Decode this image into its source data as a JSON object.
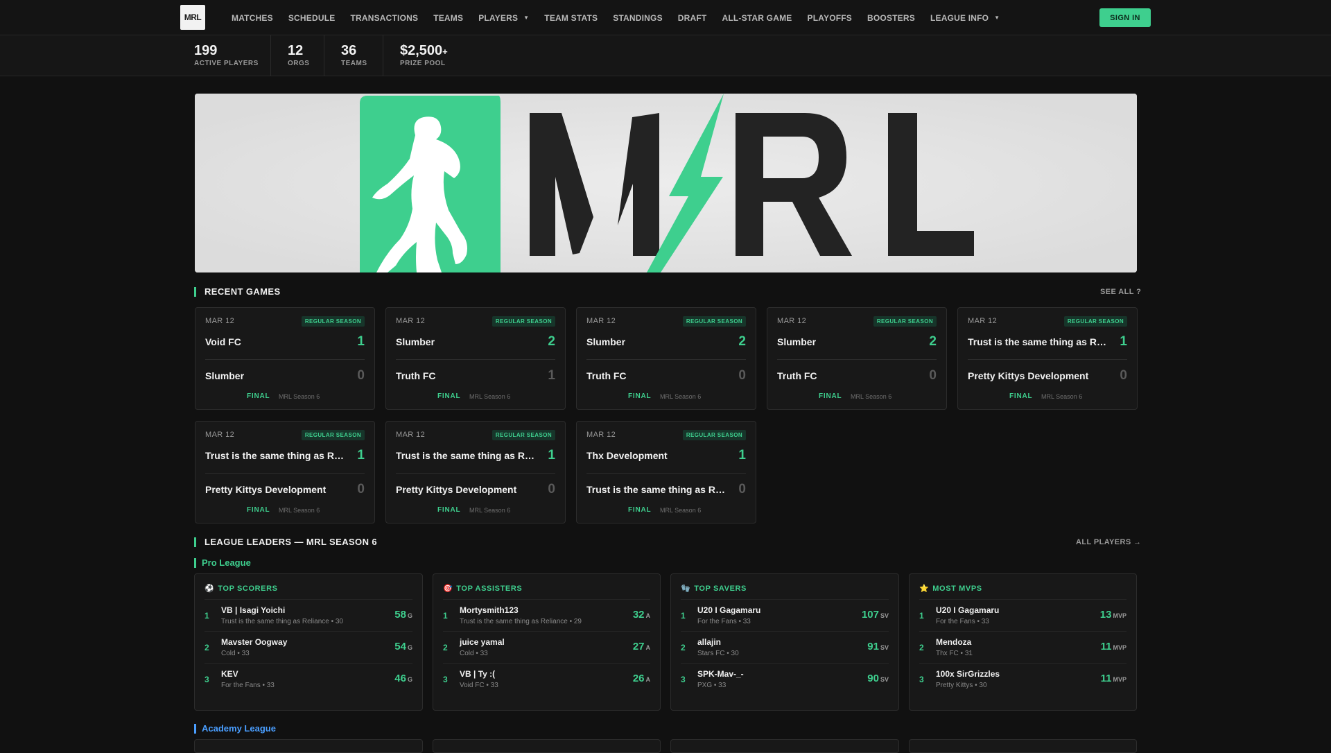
{
  "nav": {
    "logo_text": "MRL",
    "links": [
      {
        "label": "MATCHES",
        "dropdown": false
      },
      {
        "label": "SCHEDULE",
        "dropdown": false
      },
      {
        "label": "TRANSACTIONS",
        "dropdown": false
      },
      {
        "label": "TEAMS",
        "dropdown": false
      },
      {
        "label": "PLAYERS",
        "dropdown": true
      },
      {
        "label": "TEAM STATS",
        "dropdown": false
      },
      {
        "label": "STANDINGS",
        "dropdown": false
      },
      {
        "label": "DRAFT",
        "dropdown": false
      },
      {
        "label": "ALL-STAR GAME",
        "dropdown": false
      },
      {
        "label": "PLAYOFFS",
        "dropdown": false
      },
      {
        "label": "BOOSTERS",
        "dropdown": false
      },
      {
        "label": "LEAGUE INFO",
        "dropdown": true
      }
    ],
    "caret": "▼",
    "signin_label": "SIGN IN"
  },
  "stats": [
    {
      "value": "199",
      "suffix": "",
      "label": "ACTIVE PLAYERS"
    },
    {
      "value": "12",
      "suffix": "",
      "label": "ORGS"
    },
    {
      "value": "36",
      "suffix": "",
      "label": "TEAMS"
    },
    {
      "value": "$2,500",
      "suffix": "+",
      "label": "PRIZE POOL"
    }
  ],
  "banner": {
    "logo_text": "MRL"
  },
  "recent_games": {
    "title": "RECENT GAMES",
    "see_all": "SEE ALL ?",
    "games": [
      {
        "date": "MAR 12",
        "badge": "REGULAR SEASON",
        "team1": "Void FC",
        "score1": "1",
        "team2": "Slumber",
        "score2": "0",
        "status": "FINAL",
        "season": "MRL Season 6"
      },
      {
        "date": "MAR 12",
        "badge": "REGULAR SEASON",
        "team1": "Slumber",
        "score1": "2",
        "team2": "Truth FC",
        "score2": "1",
        "status": "FINAL",
        "season": "MRL Season 6"
      },
      {
        "date": "MAR 12",
        "badge": "REGULAR SEASON",
        "team1": "Slumber",
        "score1": "2",
        "team2": "Truth FC",
        "score2": "0",
        "status": "FINAL",
        "season": "MRL Season 6"
      },
      {
        "date": "MAR 12",
        "badge": "REGULAR SEASON",
        "team1": "Slumber",
        "score1": "2",
        "team2": "Truth FC",
        "score2": "0",
        "status": "FINAL",
        "season": "MRL Season 6"
      },
      {
        "date": "MAR 12",
        "badge": "REGULAR SEASON",
        "team1": "Trust is the same thing as Re...",
        "score1": "1",
        "team2": "Pretty Kittys Development",
        "score2": "0",
        "status": "FINAL",
        "season": "MRL Season 6"
      },
      {
        "date": "MAR 12",
        "badge": "REGULAR SEASON",
        "team1": "Trust is the same thing as Re...",
        "score1": "1",
        "team2": "Pretty Kittys Development",
        "score2": "0",
        "status": "FINAL",
        "season": "MRL Season 6"
      },
      {
        "date": "MAR 12",
        "badge": "REGULAR SEASON",
        "team1": "Trust is the same thing as Re...",
        "score1": "1",
        "team2": "Pretty Kittys Development",
        "score2": "0",
        "status": "FINAL",
        "season": "MRL Season 6"
      },
      {
        "date": "MAR 12",
        "badge": "REGULAR SEASON",
        "team1": "Thx Development",
        "score1": "1",
        "team2": "Trust is the same thing as Re...",
        "score2": "0",
        "status": "FINAL",
        "season": "MRL Season 6"
      }
    ]
  },
  "league_leaders": {
    "title": "LEAGUE LEADERS — MRL SEASON 6",
    "all_players": "ALL PLAYERS →",
    "pro_label": "Pro League",
    "academy_label": "Academy League",
    "categories": [
      {
        "title": "TOP SCORERS",
        "icon": "soccer-ball-icon",
        "glyph": "⚽",
        "unit": "G",
        "rows": [
          {
            "rank": "1",
            "name": "VB | Isagi Yoichi",
            "sub": "Trust is the same thing as Reliance • 30",
            "value": "58"
          },
          {
            "rank": "2",
            "name": "Mavster Oogway",
            "sub": "Cold • 33",
            "value": "54"
          },
          {
            "rank": "3",
            "name": "KEV",
            "sub": "For the Fans • 33",
            "value": "46"
          }
        ]
      },
      {
        "title": "TOP ASSISTERS",
        "icon": "target-icon",
        "glyph": "🎯",
        "unit": "A",
        "rows": [
          {
            "rank": "1",
            "name": "Mortysmith123",
            "sub": "Trust is the same thing as Reliance • 29",
            "value": "32"
          },
          {
            "rank": "2",
            "name": "juice yamal",
            "sub": "Cold • 33",
            "value": "27"
          },
          {
            "rank": "3",
            "name": "VB | Ty :(",
            "sub": "Void FC • 33",
            "value": "26"
          }
        ]
      },
      {
        "title": "TOP SAVERS",
        "icon": "goalkeeper-icon",
        "glyph": "🧤",
        "unit": "SV",
        "rows": [
          {
            "rank": "1",
            "name": "U20 I Gagamaru",
            "sub": "For the Fans • 33",
            "value": "107"
          },
          {
            "rank": "2",
            "name": "allajin",
            "sub": "Stars FC • 30",
            "value": "91"
          },
          {
            "rank": "3",
            "name": "SPK-Mav-_-",
            "sub": "PXG • 33",
            "value": "90"
          }
        ]
      },
      {
        "title": "MOST MVPS",
        "icon": "star-icon",
        "glyph": "⭐",
        "unit": "MVP",
        "rows": [
          {
            "rank": "1",
            "name": "U20 I Gagamaru",
            "sub": "For the Fans • 33",
            "value": "13"
          },
          {
            "rank": "2",
            "name": "Mendoza",
            "sub": "Thx FC • 31",
            "value": "11"
          },
          {
            "rank": "3",
            "name": "100x SirGrizzles",
            "sub": "Pretty Kittys • 30",
            "value": "11"
          }
        ]
      }
    ]
  },
  "colors": {
    "accent": "#3ecf8e",
    "academy": "#4a9eff",
    "background": "#111111"
  }
}
